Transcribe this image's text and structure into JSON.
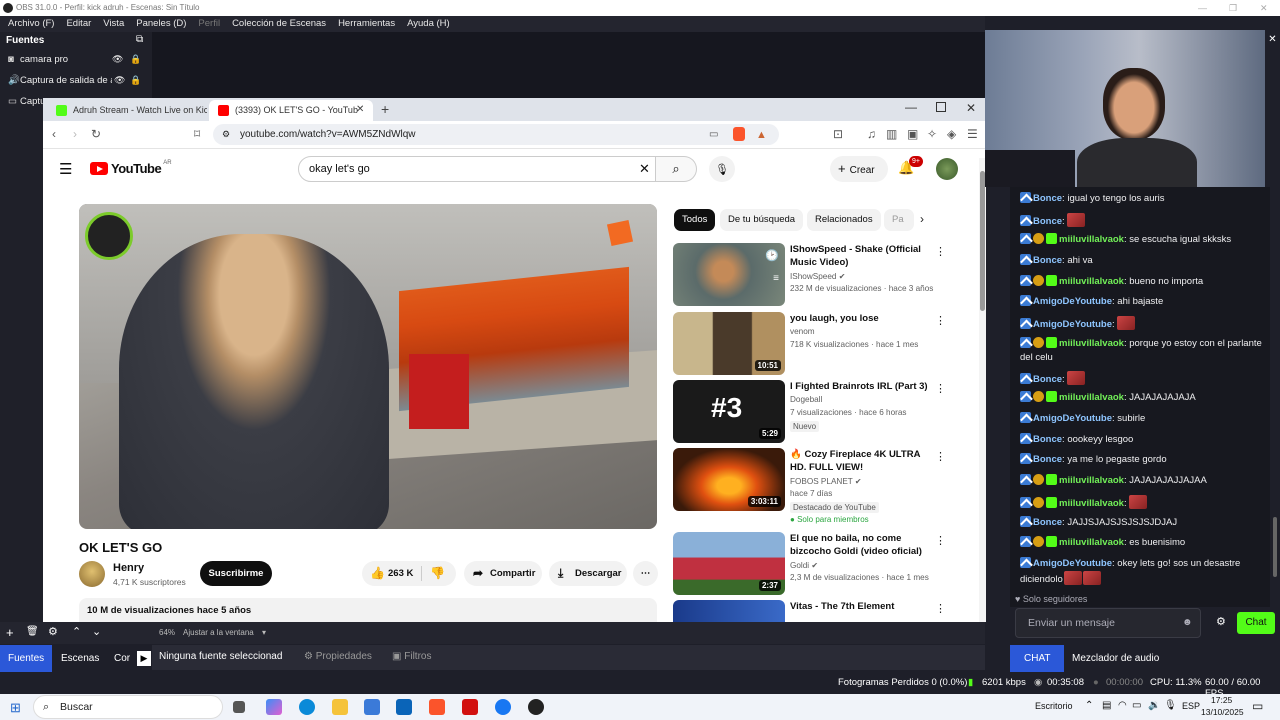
{
  "obs": {
    "title": "OBS 31.0.0 - Perfil: kick adruh - Escenas: Sin Título",
    "menu": [
      "Archivo (F)",
      "Editar",
      "Vista",
      "Paneles (D)",
      "Perfil",
      "Colección de Escenas",
      "Herramientas",
      "Ayuda (H)"
    ],
    "sources_header": "Fuentes",
    "sources": [
      {
        "label": "camara pro",
        "icon": "camera-icon"
      },
      {
        "label": "Captura de salida de au",
        "icon": "speaker-icon"
      },
      {
        "label": "Captu",
        "icon": "monitor-icon"
      }
    ],
    "zoom": "64%",
    "fit": "Ajustar a la ventana",
    "no_source": "Ninguna fuente seleccionad",
    "properties": "Propiedades",
    "filters": "Filtros",
    "dock_tabs": [
      "Fuentes",
      "Escenas",
      "Cor"
    ],
    "status": {
      "dropped": "Fotogramas Perdidos 0 (0.0%)",
      "bitrate": "6201 kbps",
      "live_time": "00:35:08",
      "rec_time": "00:00:00",
      "cpu": "CPU: 11.3%",
      "fps": "60.00 / 60.00 FPS"
    }
  },
  "browser": {
    "tabs": [
      {
        "label": "Adruh Stream - Watch Live on Kick",
        "active": false
      },
      {
        "label": "(3393) OK LET'S GO - YouTub",
        "active": true
      }
    ],
    "url": "youtube.com/watch?v=AWM5ZNdWlqw"
  },
  "youtube": {
    "logo": "YouTube",
    "region": "AR",
    "search_value": "okay let's go",
    "create": "Crear",
    "notif_badge": "9+",
    "video_title": "OK LET'S GO",
    "channel": "Henry",
    "subs": "4,71 K suscriptores",
    "subscribe": "Suscribirme",
    "likes": "263 K",
    "share": "Compartir",
    "download": "Descargar",
    "views_line": "10 M de visualizaciones  hace 5 años",
    "chips": [
      "Todos",
      "De tu búsqueda",
      "Relacionados",
      "Pa"
    ],
    "recs": [
      {
        "title": "IShowSpeed - Shake (Official Music Video)",
        "channel": "IShowSpeed",
        "meta": "232 M de visualizaciones · hace 3 años",
        "dur": ""
      },
      {
        "title": "you laugh, you lose",
        "channel": "venom",
        "meta": "718 K visualizaciones · hace 1 mes",
        "dur": "10:51"
      },
      {
        "title": "I Fighted Brainrots IRL (Part 3)",
        "channel": "Dogeball",
        "meta": "7 visualizaciones · hace 6 horas",
        "dur": "5:29",
        "tag": "Nuevo"
      },
      {
        "title": "🔥 Cozy Fireplace 4K ULTRA HD. FULL VIEW!",
        "channel": "FOBOS PLANET",
        "meta": "hace 7 días",
        "dur": "3:03:11",
        "tag": "Destacado de YouTube",
        "tag2": "Solo para miembros"
      },
      {
        "title": "El que  no baila, no come bizcocho Goldi (video oficial)",
        "channel": "Goldi",
        "meta": "2,3 M de visualizaciones · hace 1 mes",
        "dur": "2:37"
      },
      {
        "title": "Vitas - The 7th Element",
        "channel": "",
        "meta": "",
        "dur": ""
      }
    ]
  },
  "chat": {
    "messages": [
      {
        "user": "Bonce",
        "text": "igual yo tengo los auris",
        "badges": [
          "b"
        ],
        "color": "blue"
      },
      {
        "user": "Bonce",
        "text": "",
        "badges": [
          "b"
        ],
        "color": "blue",
        "emote": true
      },
      {
        "user": "miiluvillalvaok",
        "text": "se escucha igual skksks",
        "badges": [
          "b",
          "g",
          "gr"
        ],
        "color": "green"
      },
      {
        "user": "Bonce",
        "text": "ahi va",
        "badges": [
          "b"
        ],
        "color": "blue"
      },
      {
        "user": "miiluvillalvaok",
        "text": "bueno no importa",
        "badges": [
          "b",
          "g",
          "gr"
        ],
        "color": "green"
      },
      {
        "user": "AmigoDeYoutube",
        "text": "ahi bajaste",
        "badges": [
          "b"
        ],
        "color": "blue"
      },
      {
        "user": "AmigoDeYoutube",
        "text": "",
        "badges": [
          "b"
        ],
        "color": "blue",
        "emote": true
      },
      {
        "user": "miiluvillalvaok",
        "text": "porque yo estoy con el parlante del celu",
        "badges": [
          "b",
          "g",
          "gr"
        ],
        "color": "green"
      },
      {
        "user": "Bonce",
        "text": "",
        "badges": [
          "b"
        ],
        "color": "blue",
        "emote": true
      },
      {
        "user": "miiluvillalvaok",
        "text": "JAJAJAJAJAJA",
        "badges": [
          "b",
          "g",
          "gr"
        ],
        "color": "green"
      },
      {
        "user": "AmigoDeYoutube",
        "text": "subirle",
        "badges": [
          "b"
        ],
        "color": "blue"
      },
      {
        "user": "Bonce",
        "text": "oookeyy lesgoo",
        "badges": [
          "b"
        ],
        "color": "blue"
      },
      {
        "user": "Bonce",
        "text": "ya me lo pegaste gordo",
        "badges": [
          "b"
        ],
        "color": "blue"
      },
      {
        "user": "miiluvillalvaok",
        "text": "JAJAJAJAJJAJAA",
        "badges": [
          "b",
          "g",
          "gr"
        ],
        "color": "green"
      },
      {
        "user": "miiluvillalvaok",
        "text": "",
        "badges": [
          "b",
          "g",
          "gr"
        ],
        "color": "green",
        "emote": true
      },
      {
        "user": "Bonce",
        "text": "JAJJSJAJSJSJSJSJDJAJ",
        "badges": [
          "b"
        ],
        "color": "blue"
      },
      {
        "user": "miiluvillalvaok",
        "text": "es buenisimo",
        "badges": [
          "b",
          "g",
          "gr"
        ],
        "color": "green"
      },
      {
        "user": "AmigoDeYoutube",
        "text": "okey lets go! sos un desastre diciendolo",
        "badges": [
          "b"
        ],
        "color": "blue",
        "emote2": true
      }
    ],
    "followers_only": "Solo seguidores",
    "input_placeholder": "Enviar un mensaje",
    "send": "Chat",
    "tabs": [
      "CHAT",
      "Mezclador de audio"
    ]
  },
  "taskbar": {
    "search": "Buscar",
    "desktop": "Escritorio",
    "lang": "ESP",
    "time": "17:25",
    "date": "13/10/2025"
  }
}
